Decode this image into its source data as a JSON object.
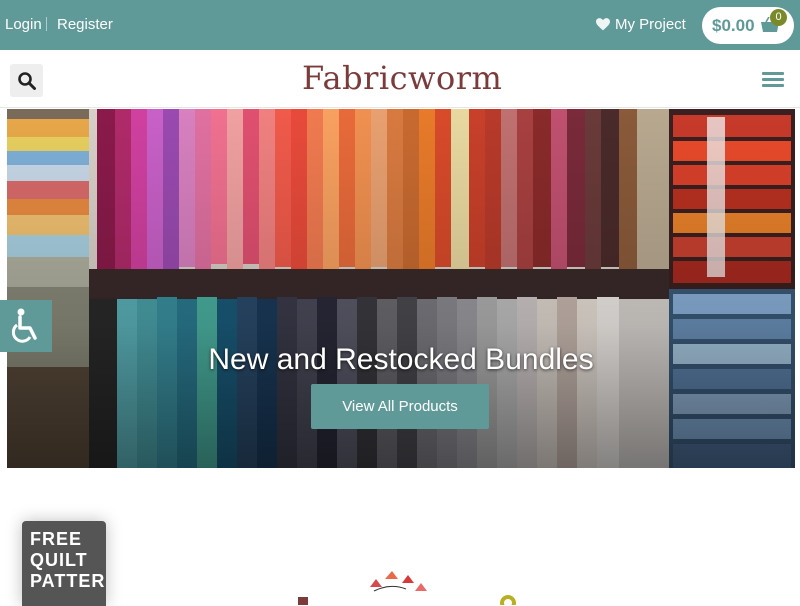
{
  "topbar": {
    "login_label": "Login",
    "register_label": "Register",
    "project_label": "My Project",
    "cart_amount": "$0.00",
    "cart_count": "0"
  },
  "header": {
    "logo_text": "Fabricworm"
  },
  "hero": {
    "heading": "New and Restocked Bundles",
    "cta_label": "View All Products"
  },
  "promo_tab": {
    "line1": "FREE",
    "line2": "QUILT",
    "line3": "PATTER"
  },
  "colors": {
    "accent": "#5f9a98",
    "logo": "#7b3b3b",
    "badge": "#7a8a2a"
  },
  "icons": [
    "heart-icon",
    "basket-icon",
    "search-icon",
    "menu-icon",
    "accessibility-icon"
  ]
}
